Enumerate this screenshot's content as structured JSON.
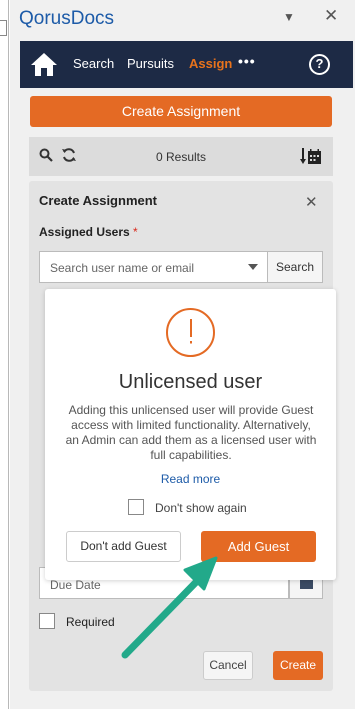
{
  "app": {
    "title": "QorusDocs"
  },
  "navbar": {
    "search": "Search",
    "pursuits": "Pursuits",
    "assign": "Assign",
    "more": "•••",
    "help": "?",
    "active_color": "#e8731c",
    "bg_color": "#1d2a45"
  },
  "create_assignment_button": "Create Assignment",
  "results_bar": {
    "count": "0 Results"
  },
  "panel": {
    "title": "Create Assignment",
    "assigned_users_label": "Assigned Users",
    "required_marker": "*",
    "user_search_placeholder": "Search user name or email",
    "search_button": "Search",
    "due_date_placeholder": "Due Date",
    "required_label": "Required",
    "cancel_button": "Cancel",
    "create_button": "Create"
  },
  "modal": {
    "heading": "Unlicensed user",
    "body": "Adding this unlicensed user will provide Guest access with limited functionality. Alternatively, an Admin can add them as a licensed user with full capabilities.",
    "read_more": "Read more",
    "dont_show_again": "Don't show again",
    "dont_add_button": "Don't add Guest",
    "add_guest_button": "Add Guest"
  },
  "colors": {
    "accent": "#e46a24",
    "brand": "#1d5ba8",
    "annotation_arrow": "#22a98a"
  },
  "icons": {
    "home": "home-icon",
    "search": "search-icon",
    "refresh": "refresh-icon",
    "sort": "sort-calendar-icon",
    "help": "help-circle-icon",
    "warning": "exclamation-circle-icon",
    "calendar": "calendar-icon"
  }
}
